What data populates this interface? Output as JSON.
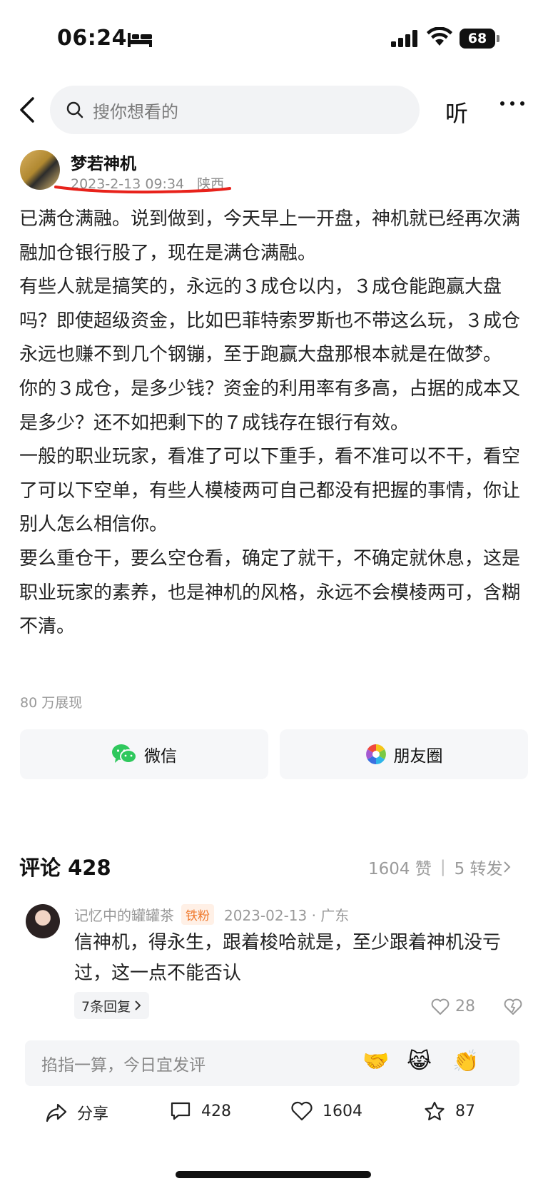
{
  "status_bar": {
    "time": "06:24",
    "battery": "68"
  },
  "search": {
    "placeholder": "搜你想看的"
  },
  "nav": {
    "listen_label": "听"
  },
  "post": {
    "author": "梦若神机",
    "date": "2023-2-13 09:34",
    "location": "陕西",
    "paragraphs": [
      "已满仓满融。说到做到，今天早上一开盘，神机就已经再次满融加仓银行股了，现在是满仓满融。",
      "有些人就是搞笑的，永远的３成仓以内，３成仓能跑赢大盘吗？即使超级资金，比如巴菲特索罗斯也不带这么玩，３成仓永远也赚不到几个钢镚，至于跑赢大盘那根本就是在做梦。",
      "你的３成仓，是多少钱？资金的利用率有多高，占据的成本又是多少？还不如把剩下的７成钱存在银行有效。",
      "一般的职业玩家，看准了可以下重手，看不准可以不干，看空了可以下空单，有些人模棱两可自己都没有把握的事情，你让别人怎么相信你。",
      "要么重仓干，要么空仓看，确定了就干，不确定就休息，这是职业玩家的素养，也是神机的风格，永远不会模棱两可，含糊不清。"
    ],
    "views": "80 万展现"
  },
  "share": {
    "wechat": "微信",
    "moments": "朋友圈"
  },
  "comments": {
    "title": "评论 428",
    "likes_stat": "1604 赞",
    "reposts_stat": "5 转发 ",
    "items": [
      {
        "user": "记忆中的罐罐茶",
        "badge": "铁粉",
        "time_location": "2023-02-13 · 广东",
        "text": "信神机，得永生，跟着梭哈就是，至少跟着神机没亏过，这一点不能否认",
        "replies": "7条回复",
        "likes": "28"
      }
    ]
  },
  "comment_input": {
    "placeholder": "掐指一算，今日宜发评",
    "emojis": [
      "🤝",
      "😹",
      "👏"
    ]
  },
  "bottom_bar": {
    "share": "分享",
    "comments": "428",
    "likes": "1604",
    "favorites": "87"
  }
}
